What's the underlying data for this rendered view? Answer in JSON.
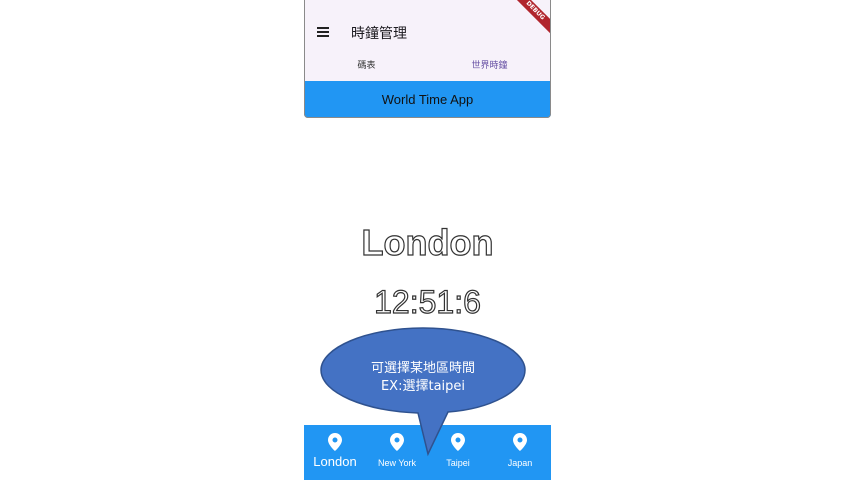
{
  "app": {
    "title": "時鐘管理",
    "debug_label": "DEBUG",
    "banner": "World Time App"
  },
  "tabs": [
    {
      "label": "碼表",
      "active": false
    },
    {
      "label": "世界時鐘",
      "active": true
    }
  ],
  "main": {
    "city": "London",
    "time": "12:51:6"
  },
  "callout": {
    "line1": "可選擇某地區時間",
    "line2": "EX:選擇taipei"
  },
  "bottom_nav": {
    "items": [
      {
        "label": "London",
        "icon": "location-pin-icon",
        "selected": true
      },
      {
        "label": "New York",
        "icon": "location-pin-icon",
        "selected": false
      },
      {
        "label": "Taipei",
        "icon": "location-pin-icon",
        "selected": false
      },
      {
        "label": "Japan",
        "icon": "location-pin-icon",
        "selected": false
      }
    ]
  },
  "colors": {
    "accent_blue": "#2196f3",
    "appbar_bg": "#f7f2fa",
    "active_tab": "#6750a4",
    "callout_fill": "#4472c4",
    "callout_stroke": "#2f528f",
    "debug_banner": "#b0252d"
  }
}
